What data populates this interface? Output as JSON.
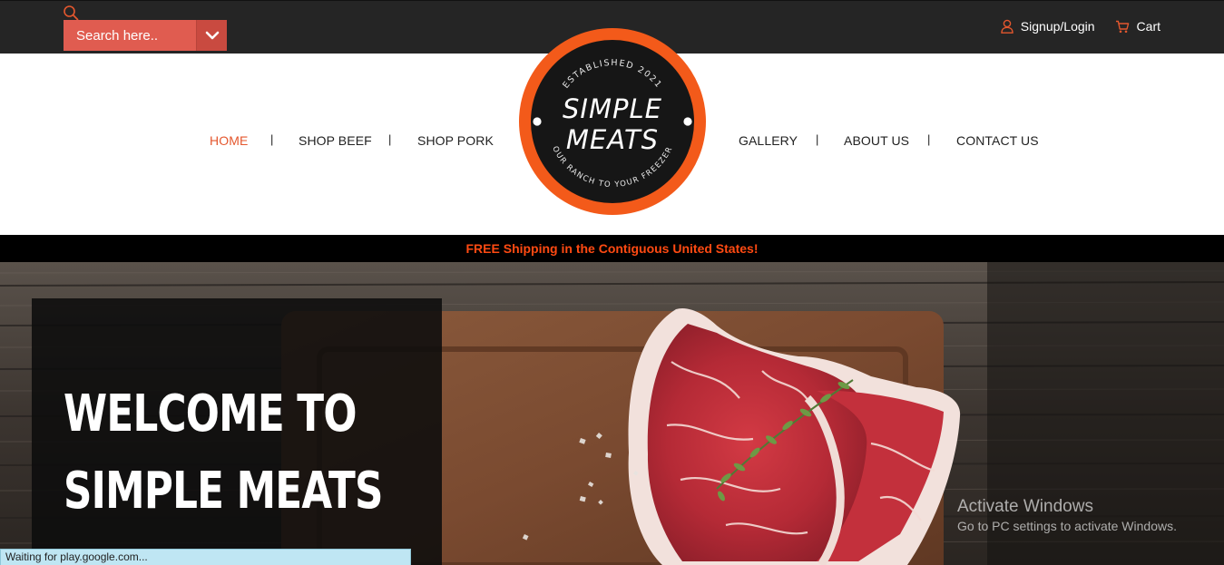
{
  "topbar": {
    "search_placeholder": "Search here..",
    "signup_login": "Signup/Login",
    "cart": "Cart"
  },
  "nav": {
    "left": [
      "HOME",
      "SHOP BEEF",
      "SHOP PORK"
    ],
    "right": [
      "GALLERY",
      "ABOUT US",
      "CONTACT US"
    ],
    "separator": "|",
    "active": "HOME"
  },
  "logo": {
    "top_text": "ESTABLISHED 2021",
    "line1": "SIMPLE",
    "line2": "MEATS",
    "bottom_text": "OUR RANCH TO YOUR FREEZER"
  },
  "banner": {
    "text": "FREE Shipping in the Contiguous United States!"
  },
  "hero": {
    "title_line1": "WELCOME TO",
    "title_line2": "SIMPLE MEATS"
  },
  "watermark": {
    "title": "Activate Windows",
    "subtitle": "Go to PC settings to activate Windows."
  },
  "status_bar": {
    "text": "Waiting for play.google.com..."
  },
  "colors": {
    "accent": "#e4572e",
    "search_bg": "#e05c50",
    "topbar_bg": "#252525",
    "banner_text": "#ff4a12",
    "logo_ring": "#f35a1a"
  },
  "icons": [
    "search-icon",
    "chevron-down-icon",
    "user-icon",
    "cart-icon"
  ]
}
